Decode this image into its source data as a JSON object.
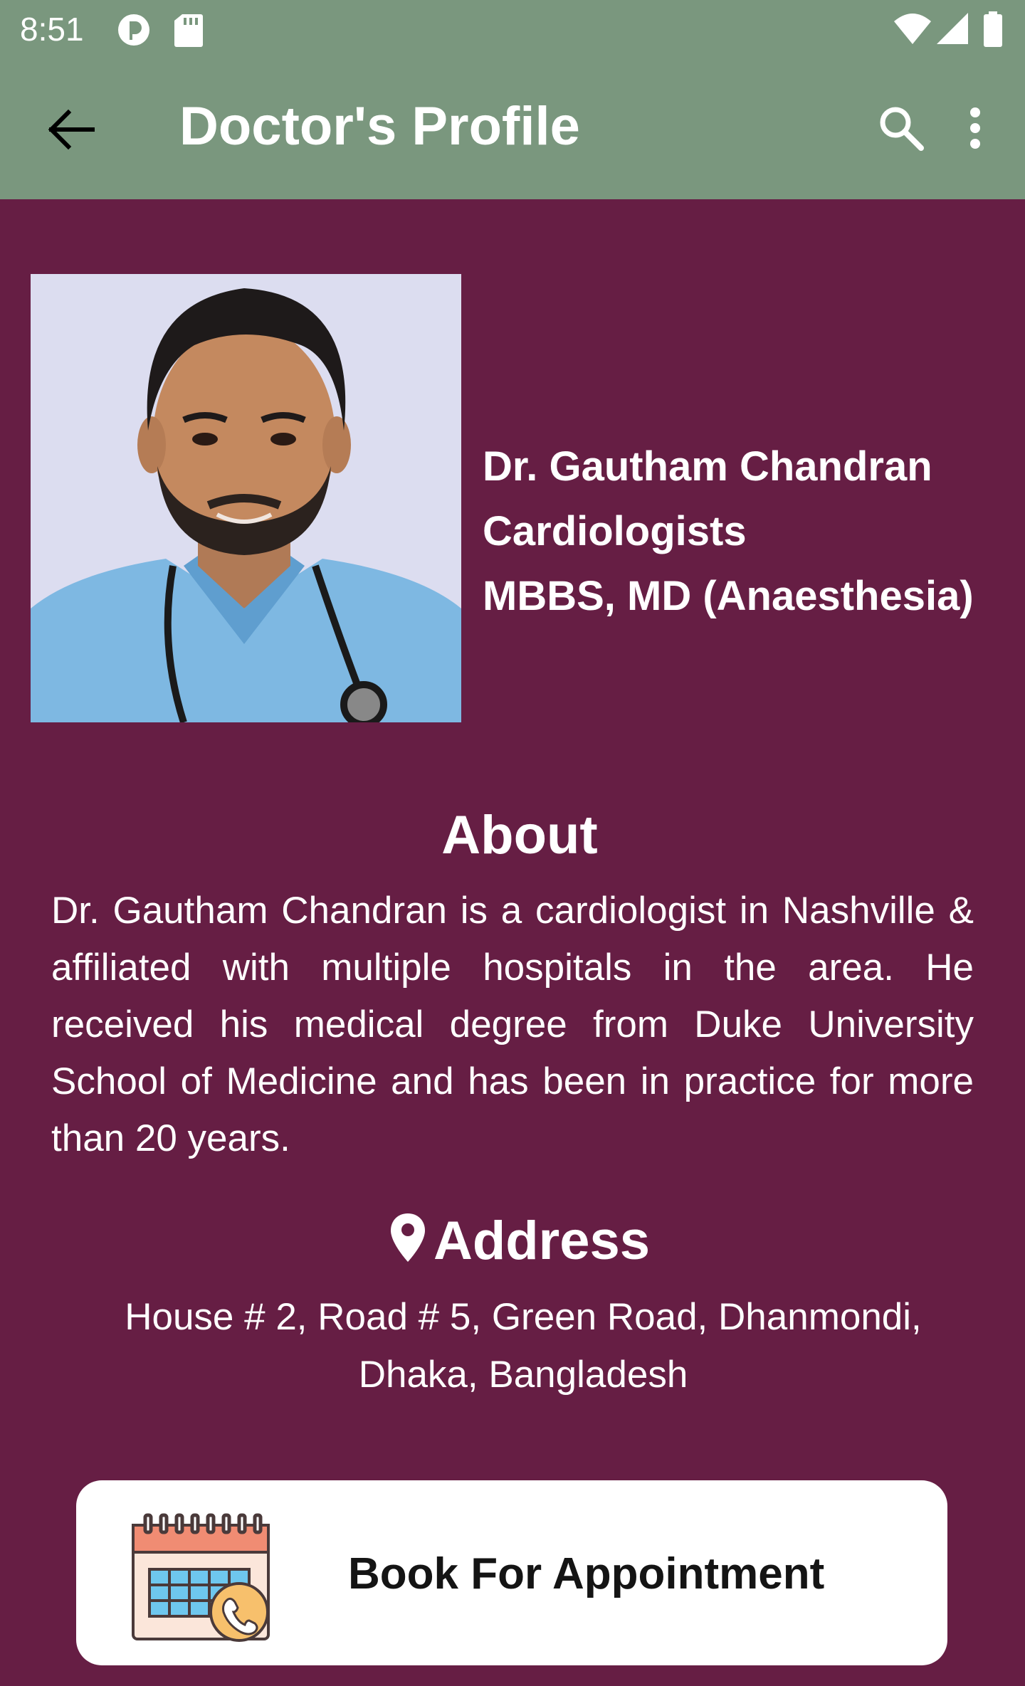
{
  "status_bar": {
    "time": "8:51"
  },
  "app_bar": {
    "title": "Doctor's Profile",
    "icons": [
      "back-arrow-icon",
      "search-icon",
      "more-vert-icon"
    ]
  },
  "doctor": {
    "name": "Dr. Gautham Chandran",
    "specialty": "Cardiologists",
    "degrees": "MBBS, MD (Anaesthesia)"
  },
  "about": {
    "title": "About",
    "text": "Dr. Gautham Chandran is a cardiologist in Nashville & affiliated with multiple hospitals in the area. He received his medical degree from Duke University School of Medicine and has been in practice for more than 20 years."
  },
  "address": {
    "title": "Address",
    "line1": "House # 2, Road # 5, Green Road, Dhanmondi,",
    "line2": "Dhaka, Bangladesh"
  },
  "book_button": {
    "label": "Book For Appointment"
  },
  "colors": {
    "background": "#661E44",
    "app_bar": "#7A977E",
    "button_bg": "#FFFFFF"
  }
}
